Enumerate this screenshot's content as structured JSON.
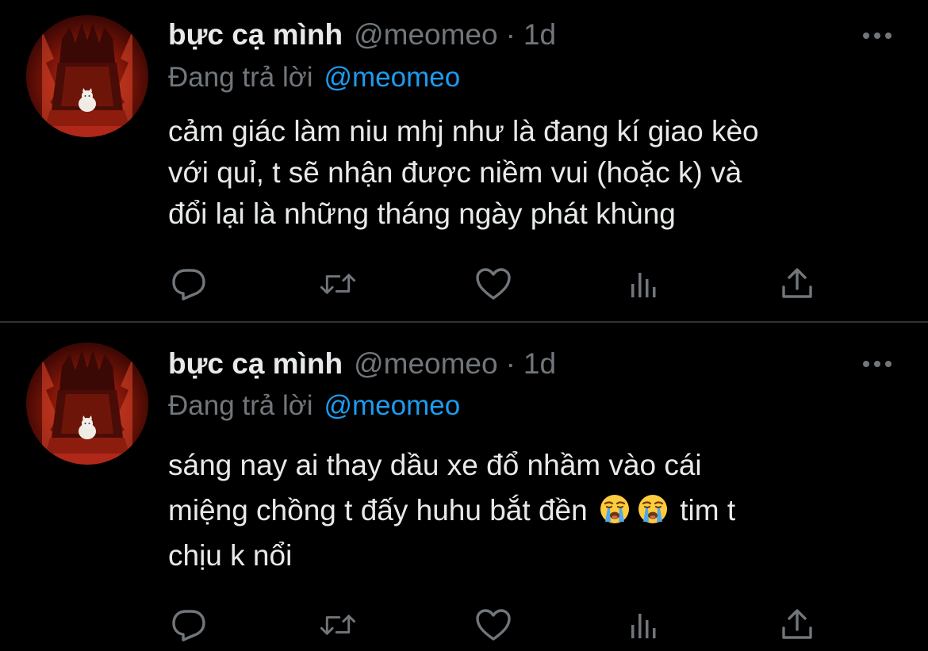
{
  "tweets": [
    {
      "author_name": "bực cạ mình",
      "handle": "@meomeo",
      "separator": "·",
      "time": "1d",
      "reply_label": "Đang trả lời",
      "reply_to": "@meomeo",
      "text": "cảm giác làm niu mhj như là đang kí giao kèo\nvới quỉ, t sẽ nhận được niềm vui (hoặc k) và\nđổi lại là những tháng ngày phát khùng",
      "actions": [
        "reply-icon",
        "retweet-icon",
        "like-icon",
        "views-icon",
        "share-icon"
      ]
    },
    {
      "author_name": "bực cạ mình",
      "handle": "@meomeo",
      "separator": "·",
      "time": "1d",
      "reply_label": "Đang trả lời",
      "reply_to": "@meomeo",
      "text_line1": "sáng nay ai thay dầu xe đổ nhầm vào cái",
      "text_line2_before": "miệng chồng t đấy huhu bắt đền",
      "emojis": [
        "loudly-crying-face",
        "loudly-crying-face"
      ],
      "text_line2_after": "tim t",
      "text_line3": "chịu k nổi",
      "actions": [
        "reply-icon",
        "retweet-icon",
        "like-icon",
        "views-icon",
        "share-icon"
      ]
    }
  ],
  "colors": {
    "background": "#000000",
    "primary_text": "#e7e9ea",
    "secondary_text": "#71767b",
    "mention": "#1d9bf0",
    "divider": "#2f3336"
  }
}
